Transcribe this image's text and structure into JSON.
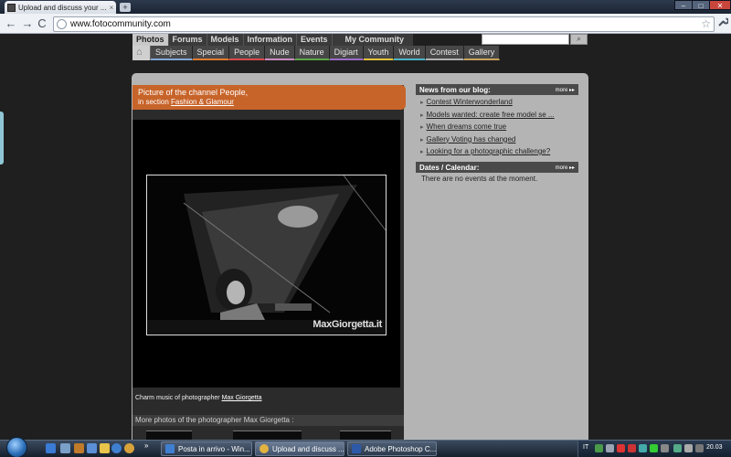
{
  "browser": {
    "tab_title": "Upload and discuss your ...",
    "tab_close": "×",
    "newtab": "+",
    "url": "www.fotocommunity.com",
    "back_icon": "←",
    "forward_icon": "→",
    "reload_icon": "C",
    "star_icon": "☆",
    "wrench_icon": "🔧",
    "min_icon": "–",
    "max_icon": "□",
    "close_icon": "✕"
  },
  "site": {
    "main_nav": [
      "Photos",
      "Forums",
      "Models",
      "Information",
      "Events",
      "My Community"
    ],
    "sub_nav": [
      "Subjects",
      "Special",
      "People",
      "Nude",
      "Nature",
      "Digiart",
      "Youth",
      "World",
      "Contest",
      "Gallery"
    ],
    "sub_nav_colors": [
      "#7fa7d8",
      "#e07a2e",
      "#d94a4a",
      "#c98ac0",
      "#5aa846",
      "#9b6bc8",
      "#e2c23a",
      "#4ab3c9",
      "#b0b0b0",
      "#c7a25a"
    ],
    "search_button_icon": "⌕",
    "home_icon": "⌂"
  },
  "channel": {
    "title": "Picture of the channel People,",
    "section_prefix": "in section",
    "section_link": "Fashion & Glamour"
  },
  "photo": {
    "watermark": "MaxGiorgetta.it",
    "caption_prefix": "Charm music of photographer",
    "caption_link": "Max Giorgetta"
  },
  "more_photos": {
    "label": "More photos of the photographer Max Giorgetta :"
  },
  "blog": {
    "title": "News from our blog:",
    "more": "more ▸▸",
    "items": [
      "Contest Winterwonderland",
      "Models wanted: create free model se ...",
      "When dreams come true",
      "Gallery Voting has changed",
      "Looking for a photographic challenge?"
    ]
  },
  "calendar": {
    "title": "Dates / Calendar:",
    "more": "more ▸▸",
    "empty": "There are no events at the moment."
  },
  "taskbar": {
    "tasks": [
      {
        "label": "Posta in arrivo - Win...",
        "color": "#3f7fd0"
      },
      {
        "label": "Upload and discuss ...",
        "color": "#e2b341"
      },
      {
        "label": "Adobe Photoshop C...",
        "color": "#2d5aa8"
      }
    ],
    "lang": "IT",
    "clock": "20.03"
  }
}
